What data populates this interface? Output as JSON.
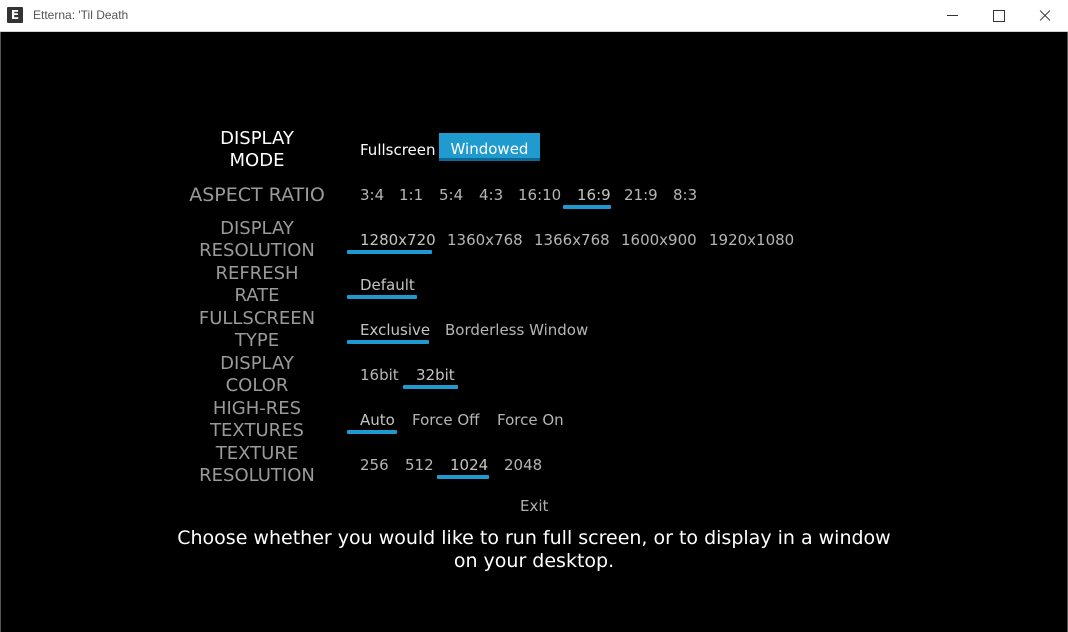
{
  "window": {
    "title": "Etterna: 'Til Death",
    "icon_letter": "E"
  },
  "rows": [
    {
      "label": "DISPLAY\nMODE",
      "active": true,
      "options": [
        "Fullscreen",
        "Windowed"
      ],
      "selected": 1
    },
    {
      "label": "ASPECT RATIO",
      "active": false,
      "options": [
        "3:4",
        "1:1",
        "5:4",
        "4:3",
        "16:10",
        "16:9",
        "21:9",
        "8:3"
      ],
      "selected": 5
    },
    {
      "label": "DISPLAY\nRESOLUTION",
      "active": false,
      "options": [
        "1280x720",
        "1360x768",
        "1366x768",
        "1600x900",
        "1920x1080"
      ],
      "selected": 0
    },
    {
      "label": "REFRESH\nRATE",
      "active": false,
      "options": [
        "Default"
      ],
      "selected": 0
    },
    {
      "label": "FULLSCREEN\nTYPE",
      "active": false,
      "options": [
        "Exclusive",
        "Borderless Window"
      ],
      "selected": 0
    },
    {
      "label": "DISPLAY\nCOLOR",
      "active": false,
      "options": [
        "16bit",
        "32bit"
      ],
      "selected": 1
    },
    {
      "label": "HIGH-RES\nTEXTURES",
      "active": false,
      "options": [
        "Auto",
        "Force Off",
        "Force On"
      ],
      "selected": 0
    },
    {
      "label": "TEXTURE\nRESOLUTION",
      "active": false,
      "options": [
        "256",
        "512",
        "1024",
        "2048"
      ],
      "selected": 2
    }
  ],
  "exit_label": "Exit",
  "help_text": "Choose whether you would like to run full screen, or to display in a window on your desktop.",
  "colors": {
    "accent": "#1e9ad0",
    "background": "#000000",
    "label_inactive": "#9a9a9a",
    "label_active": "#ffffff"
  }
}
